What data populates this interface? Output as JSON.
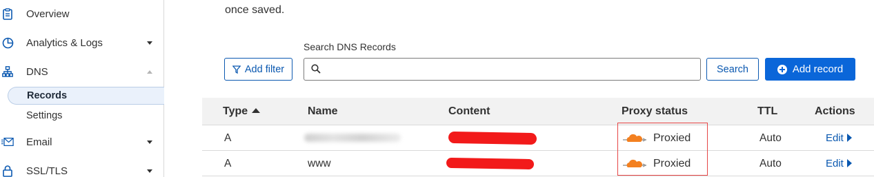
{
  "sidebar": {
    "items": [
      {
        "label": "Overview",
        "icon": "clipboard-icon"
      },
      {
        "label": "Analytics & Logs",
        "icon": "pie-chart-icon"
      },
      {
        "label": "DNS",
        "icon": "network-icon"
      },
      {
        "label": "Email",
        "icon": "email-icon"
      },
      {
        "label": "SSL/TLS",
        "icon": "lock-icon"
      }
    ],
    "dns_sub": [
      {
        "label": "Records",
        "active": true
      },
      {
        "label": "Settings",
        "active": false
      }
    ]
  },
  "main": {
    "top_text": "once saved.",
    "search_label": "Search DNS Records",
    "search_value": "",
    "add_filter_label": "Add filter",
    "search_button_label": "Search",
    "add_record_label": "Add record"
  },
  "table": {
    "headers": [
      "Type",
      "Name",
      "Content",
      "Proxy status",
      "TTL",
      "Actions"
    ],
    "sort_column": "Type",
    "rows": [
      {
        "type": "A",
        "name": "",
        "name_obscured": true,
        "content_redacted": true,
        "proxy_status": "Proxied",
        "ttl": "Auto",
        "action": "Edit"
      },
      {
        "type": "A",
        "name": "www",
        "name_obscured": false,
        "content_redacted": true,
        "proxy_status": "Proxied",
        "ttl": "Auto",
        "action": "Edit"
      }
    ]
  },
  "colors": {
    "accent": "#0a58b0",
    "primary_button": "#0a66d9",
    "cloud_orange": "#f38020",
    "highlight": "#e64545",
    "redaction": "#f21a1a"
  }
}
